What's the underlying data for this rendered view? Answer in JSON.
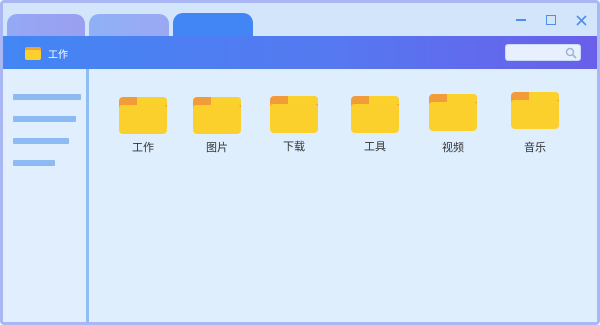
{
  "window": {
    "tabs": [
      "",
      "",
      ""
    ],
    "controls": [
      "minimize",
      "maximize",
      "close"
    ]
  },
  "toolbar": {
    "path_icon": "folder-icon",
    "path_label": "工作",
    "search_placeholder": "",
    "search_icon": "search-icon"
  },
  "sidebar": {
    "items": [
      "",
      "",
      "",
      ""
    ]
  },
  "main": {
    "folders": [
      {
        "label": "工作",
        "icon": "folder-icon"
      },
      {
        "label": "图片",
        "icon": "folder-icon"
      },
      {
        "label": "下载",
        "icon": "folder-icon"
      },
      {
        "label": "工具",
        "icon": "folder-icon"
      },
      {
        "label": "视频",
        "icon": "folder-icon"
      },
      {
        "label": "音乐",
        "icon": "folder-icon"
      }
    ]
  },
  "colors": {
    "accent": "#4285f4",
    "toolbar_gradient_end": "#6a5fea",
    "folder": "#fbd02c",
    "folder_back": "#f19c38",
    "sidebar_lines": "#8bbbf2",
    "background": "#dfeefd"
  }
}
